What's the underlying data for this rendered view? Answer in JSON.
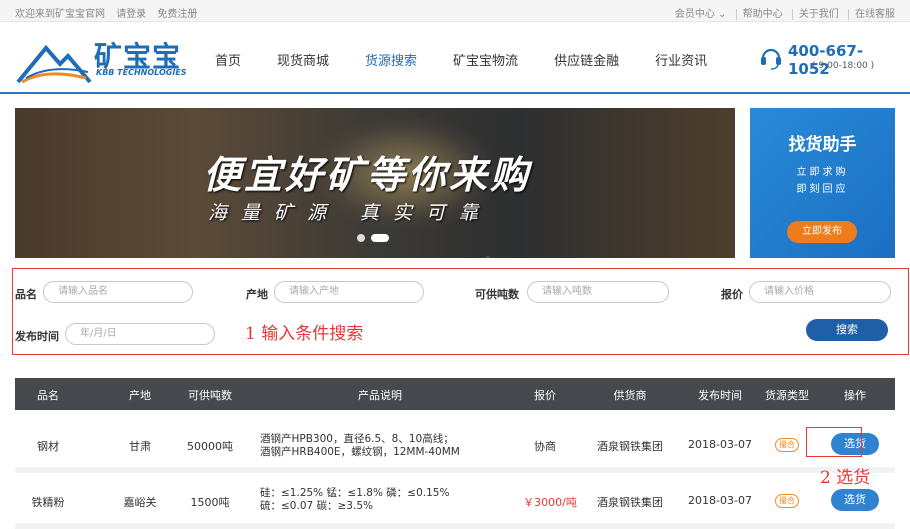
{
  "topbar": {
    "welcome": "欢迎来到矿宝宝官网",
    "login": "请登录",
    "register": "免费注册",
    "member": "会员中心 ⌄",
    "help": "帮助中心",
    "about": "关于我们",
    "service": "在线客服"
  },
  "header": {
    "brand": "矿宝宝",
    "brand_sub": "KBB TECHNOLOGIES",
    "nav": [
      "首页",
      "现货商城",
      "货源搜索",
      "矿宝宝物流",
      "供应链金融",
      "行业资讯"
    ],
    "active_nav": "货源搜索",
    "phone": "400-667-1052",
    "hours": "( 9:00-18:00 )"
  },
  "banner": {
    "headline": "便宜好矿等你来购",
    "subline": "海量矿源 真实可靠"
  },
  "helper": {
    "title": "找货助手",
    "line1": "立即求购",
    "line2": "即刻回应",
    "button": "立即发布"
  },
  "search": {
    "name_label": "品名",
    "name_placeholder": "请输入品名",
    "origin_label": "产地",
    "origin_placeholder": "请输入产地",
    "tonnage_label": "可供吨数",
    "tonnage_placeholder": "请输入吨数",
    "price_label": "报价",
    "price_placeholder": "请输入价格",
    "date_label": "发布时间",
    "date_placeholder": "年/月/日",
    "button": "搜索",
    "annotation": "1 输入条件搜索"
  },
  "table": {
    "headers": [
      "品名",
      "产地",
      "可供吨数",
      "产品说明",
      "报价",
      "供货商",
      "发布时间",
      "货源类型",
      "操作"
    ],
    "rows": [
      {
        "name": "钢材",
        "origin": "甘肃",
        "tonnage": "50000吨",
        "desc1": "酒钢产HPB300，直径6.5、8、10高线；",
        "desc2": "酒钢产HRB400E，螺纹钢，12MM-40MM",
        "price": "协商",
        "supplier": "酒泉钢铁集团",
        "date": "2018-03-07",
        "type": "撮合",
        "action": "选货"
      },
      {
        "name": "铁精粉",
        "origin": "嘉峪关",
        "tonnage": "1500吨",
        "desc1": "硅：≤1.25%    锰：≤1.8%    磷：≤0.15%",
        "desc2": "硫：≤0.07    碳：≥3.5%",
        "price": "￥3000/吨",
        "supplier": "酒泉钢铁集团",
        "date": "2018-03-07",
        "type": "撮合",
        "action": "选货"
      }
    ],
    "annotation": "2 选货"
  }
}
